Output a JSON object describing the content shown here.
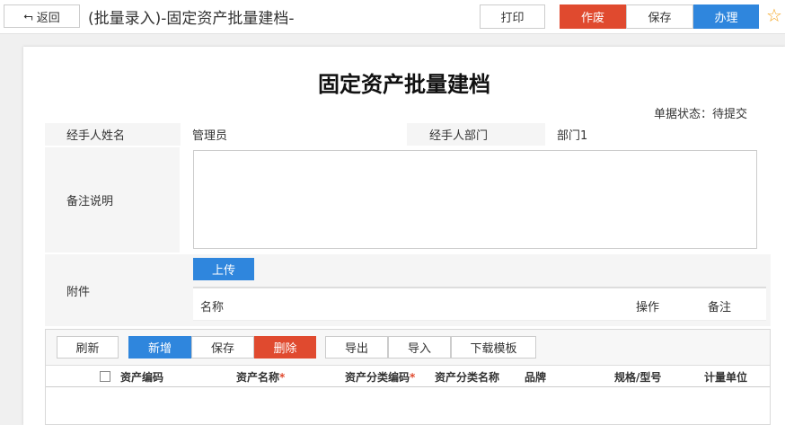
{
  "header": {
    "back_label": "返回",
    "title": "(批量录入)-固定资产批量建档-",
    "print_label": "打印",
    "void_label": "作废",
    "save_label": "保存",
    "handle_label": "办理"
  },
  "form": {
    "title": "固定资产批量建档",
    "status": "单据状态：待提交",
    "handler_name_label": "经手人姓名",
    "handler_name_value": "管理员",
    "handler_dept_label": "经手人部门",
    "handler_dept_value": "部门1",
    "remark_label": "备注说明",
    "remark_value": "",
    "attachment_label": "附件",
    "upload_label": "上传",
    "attachment_columns": [
      "名称",
      "操作",
      "备注"
    ]
  },
  "grid": {
    "toolbar": {
      "refresh": "刷新",
      "add": "新增",
      "save": "保存",
      "delete": "删除",
      "export": "导出",
      "import": "导入",
      "download_template": "下载模板"
    },
    "columns": [
      "资产编码",
      "资产名称",
      "资产分类编码",
      "资产分类名称",
      "品牌",
      "规格/型号",
      "计量单位"
    ],
    "required_mark": "*"
  },
  "colors": {
    "danger": "#e04a2f",
    "primary": "#2f86dd",
    "star": "#f5a623"
  },
  "icons": {
    "back": "back-arrow-icon",
    "favorite": "star-outline-icon"
  }
}
